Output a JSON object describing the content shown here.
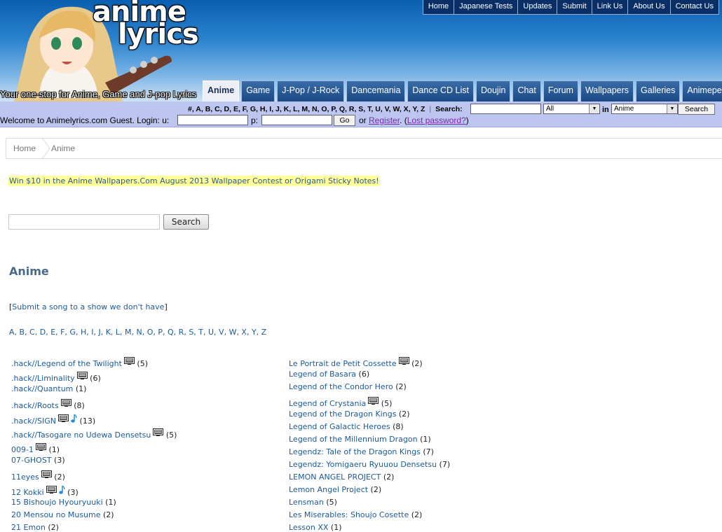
{
  "header": {
    "logo_line1": "anime",
    "logo_line2": "lyrics",
    "tagline": "Your one-stop for Anime, Game and J-pop Lyrics"
  },
  "top_nav": [
    "Home",
    "Japanese Tests",
    "Updates",
    "Submit",
    "Link Us",
    "About Us",
    "Contact Us"
  ],
  "tabs": [
    {
      "label": "Anime",
      "active": true
    },
    {
      "label": "Game",
      "active": false
    },
    {
      "label": "J-Pop / J-Rock",
      "active": false
    },
    {
      "label": "Dancemania",
      "active": false
    },
    {
      "label": "Dance CD List",
      "active": false
    },
    {
      "label": "Doujin",
      "active": false
    },
    {
      "label": "Chat",
      "active": false
    },
    {
      "label": "Forum",
      "active": false
    },
    {
      "label": "Wallpapers",
      "active": false
    },
    {
      "label": "Galleries",
      "active": false
    },
    {
      "label": "Animepedia",
      "active": false
    }
  ],
  "bar": {
    "letters": "#, A, B, C, D, E, F, G, H, I, J, K, L, M, N, O, P, Q, R, S, T, U, V, W, X, Y, Z",
    "search_label": "Search:",
    "search_value": "",
    "scope_select": "All",
    "in_label": "in",
    "category_select": "Anime",
    "search_button": "Search",
    "welcome_text": "Welcome to Animelyrics.com Guest. Login: u:",
    "password_label": "p:",
    "go_button": "Go",
    "or_text": "or",
    "register_link": "Register",
    "lost_password_link": "Lost password?"
  },
  "breadcrumb": {
    "home": "Home",
    "current": "Anime"
  },
  "promo": "Win $10 in the Anime Wallpapers.Com August 2013 Wallpaper Contest or Origami Sticky Notes!",
  "search": {
    "button": "Search",
    "value": ""
  },
  "page_title": "Anime",
  "submit_link": "Submit a song to a show we don't have",
  "alphabet": "A, B, C, D, E, F, G, H, I, J, K, L, M, N, O, P, Q, R, S, T, U, V, W, X, Y, Z",
  "left_list": [
    {
      "title": ".hack//Legend of the Twilight",
      "tv": true,
      "note": false,
      "count": "(5)"
    },
    {
      "title": ".hack//Liminality",
      "tv": true,
      "note": false,
      "count": "(6)"
    },
    {
      "title": ".hack//Quantum",
      "tv": false,
      "note": false,
      "count": "(1)"
    },
    {
      "title": ".hack//Roots",
      "tv": true,
      "note": false,
      "count": "(8)"
    },
    {
      "title": ".hack//SIGN",
      "tv": true,
      "note": true,
      "count": "(13)"
    },
    {
      "title": ".hack//Tasogare no Udewa Densetsu",
      "tv": true,
      "note": false,
      "count": "(5)"
    },
    {
      "title": "009-1",
      "tv": true,
      "note": false,
      "count": "(1)"
    },
    {
      "title": "07-GHOST",
      "tv": false,
      "note": false,
      "count": "(3)"
    },
    {
      "title": "11eyes",
      "tv": true,
      "note": false,
      "count": "(2)"
    },
    {
      "title": "12 Kokki",
      "tv": true,
      "note": true,
      "count": "(3)"
    },
    {
      "title": "15 Bishoujo Hyouryuuki",
      "tv": false,
      "note": false,
      "count": "(1)"
    },
    {
      "title": "20 Mensou no Musume",
      "tv": false,
      "note": false,
      "count": "(2)"
    },
    {
      "title": "21 Emon",
      "tv": false,
      "note": false,
      "count": "(2)"
    }
  ],
  "right_list": [
    {
      "title": "Le Portrait de Petit Cossette",
      "tv": true,
      "note": false,
      "count": "(2)"
    },
    {
      "title": "Legend of Basara",
      "tv": false,
      "note": false,
      "count": "(6)"
    },
    {
      "title": "Legend of the Condor Hero",
      "tv": false,
      "note": false,
      "count": "(2)"
    },
    {
      "title": "Legend of Crystania",
      "tv": true,
      "note": false,
      "count": "(5)"
    },
    {
      "title": "Legend of the Dragon Kings",
      "tv": false,
      "note": false,
      "count": "(2)"
    },
    {
      "title": "Legend of Galactic Heroes",
      "tv": false,
      "note": false,
      "count": "(8)"
    },
    {
      "title": "Legend of the Millennium Dragon",
      "tv": false,
      "note": false,
      "count": "(1)"
    },
    {
      "title": "Legendz: Tale of the Dragon Kings",
      "tv": false,
      "note": false,
      "count": "(7)"
    },
    {
      "title": "Legendz: Yomigaeru Ryuuou Densetsu",
      "tv": false,
      "note": false,
      "count": "(7)"
    },
    {
      "title": "LEMON ANGEL PROJECT",
      "tv": false,
      "note": false,
      "count": "(2)"
    },
    {
      "title": "Lemon Angel Project",
      "tv": false,
      "note": false,
      "count": "(2)"
    },
    {
      "title": "Lensman",
      "tv": false,
      "note": false,
      "count": "(5)"
    },
    {
      "title": "Les Miserables: Shoujo Cosette",
      "tv": false,
      "note": false,
      "count": "(2)"
    },
    {
      "title": "Lesson XX",
      "tv": false,
      "note": false,
      "count": "(1)"
    }
  ]
}
